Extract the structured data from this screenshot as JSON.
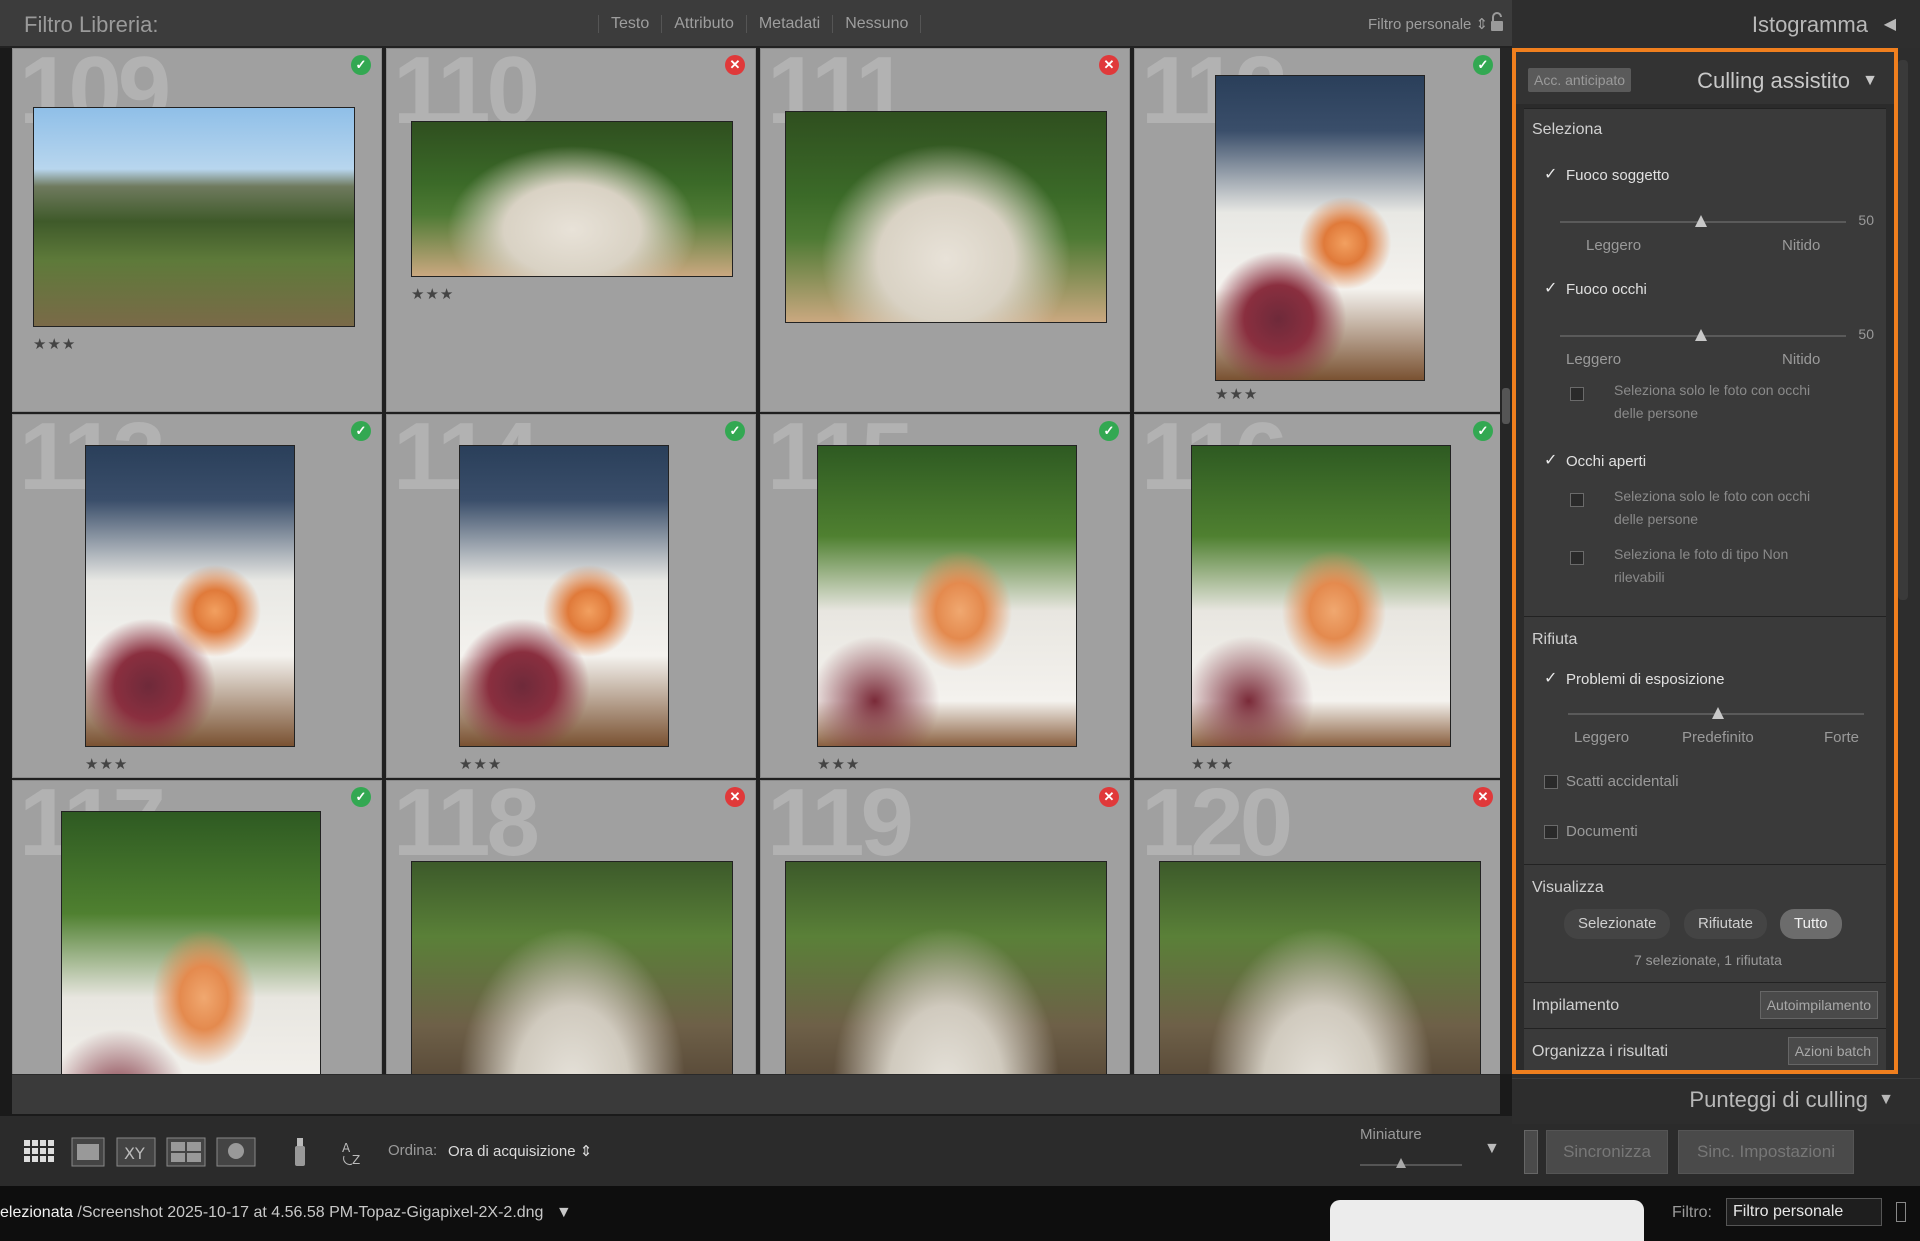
{
  "filterbar": {
    "title": "Filtro Libreria:",
    "options": [
      "Testo",
      "Attributo",
      "Metadati",
      "Nessuno"
    ],
    "preset": "Filtro personale ⇕"
  },
  "grid": {
    "cells": [
      {
        "num": "109",
        "flag": "pick",
        "stars": "★★★",
        "photo": "land"
      },
      {
        "num": "110",
        "flag": "reject",
        "stars": "★★★",
        "photo": "garden"
      },
      {
        "num": "111",
        "flag": "reject",
        "stars": "",
        "photo": "garden"
      },
      {
        "num": "112",
        "flag": "pick",
        "stars": "★★★",
        "photo": "table"
      },
      {
        "num": "113",
        "flag": "pick",
        "stars": "★★★",
        "photo": "table"
      },
      {
        "num": "114",
        "flag": "pick",
        "stars": "★★★",
        "photo": "table"
      },
      {
        "num": "115",
        "flag": "pick",
        "stars": "★★★",
        "photo": "bottle"
      },
      {
        "num": "116",
        "flag": "pick",
        "stars": "★★★",
        "photo": "bottle"
      },
      {
        "num": "117",
        "flag": "pick",
        "stars": "",
        "photo": "bottle"
      },
      {
        "num": "118",
        "flag": "reject",
        "stars": "",
        "photo": "group"
      },
      {
        "num": "119",
        "flag": "reject",
        "stars": "",
        "photo": "group"
      },
      {
        "num": "120",
        "flag": "reject",
        "stars": "",
        "photo": "group"
      }
    ]
  },
  "histogram": {
    "label": "Istogramma"
  },
  "culling": {
    "acc": "Acc. anticipato",
    "title": "Culling assistito",
    "seleziona": {
      "head": "Seleziona",
      "fuoco_soggetto": "Fuoco soggetto",
      "fs_value": "50",
      "fs_left": "Leggero",
      "fs_right": "Nitido",
      "fuoco_occhi": "Fuoco occhi",
      "fo_value": "50",
      "fo_left": "Leggero",
      "fo_right": "Nitido",
      "fo_sub": "Seleziona solo le foto con occhi delle persone",
      "occhi_aperti": "Occhi aperti",
      "oa_sub1": "Seleziona solo le foto con occhi delle persone",
      "oa_sub2": "Seleziona le foto di tipo Non rilevabili"
    },
    "rifiuta": {
      "head": "Rifiuta",
      "esposizione": "Problemi di esposizione",
      "left": "Leggero",
      "mid": "Predefinito",
      "right": "Forte",
      "scatti": "Scatti accidentali",
      "documenti": "Documenti"
    },
    "visualizza": {
      "head": "Visualizza",
      "btn1": "Selezionate",
      "btn2": "Rifiutate",
      "btn3": "Tutto",
      "summary": "7 selezionate, 1 rifiutata"
    },
    "impilamento": {
      "label": "Impilamento",
      "button": "Autoimpilamento"
    },
    "organizza": {
      "label": "Organizza i risultati",
      "button": "Azioni batch"
    }
  },
  "punteggi": {
    "label": "Punteggi di culling"
  },
  "sync": {
    "sync": "Sincronizza",
    "settings": "Sinc. Impostazioni"
  },
  "toolbar": {
    "sort_label": "Ordina:",
    "sort_value": "Ora di acquisizione ⇕",
    "thumb_label": "Miniature"
  },
  "status": {
    "prefix": "elezionata",
    "path": " /Screenshot 2025-10-17 at 4.56.58 PM-Topaz-Gigapixel-2X-2.dng",
    "filter_label": "Filtro:",
    "filter_value": "Filtro personale"
  },
  "colors": {
    "accent": "#f07f1e",
    "pick": "#33a852",
    "reject": "#e0393a"
  }
}
